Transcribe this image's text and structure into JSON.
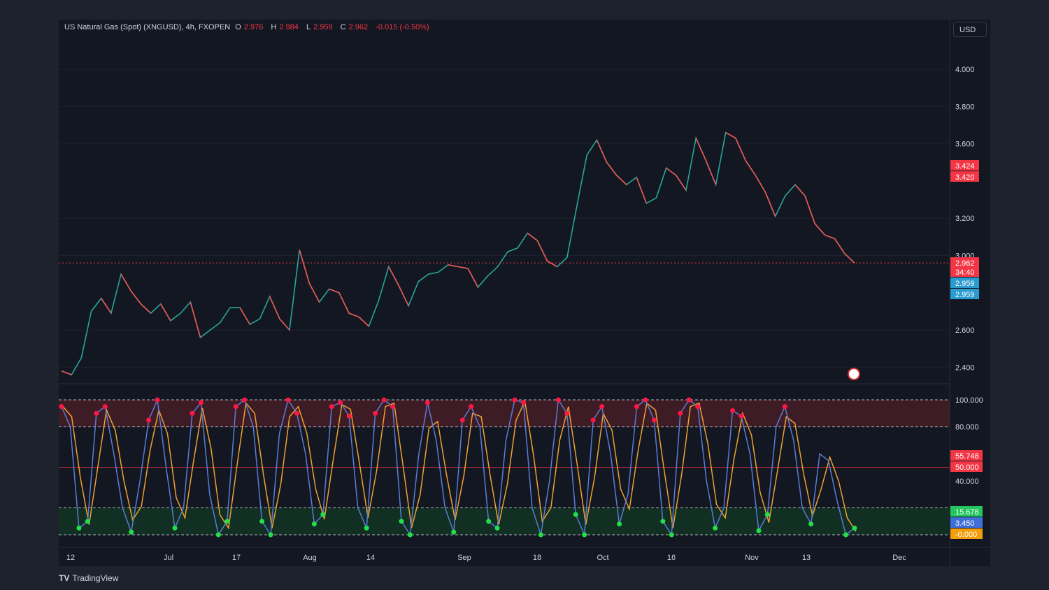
{
  "header": {
    "symbol": "US Natural Gas (Spot) (XNGUSD), 4h, FXOPEN",
    "o_label": "O",
    "o_value": "2.976",
    "h_label": "H",
    "h_value": "2.984",
    "l_label": "L",
    "l_value": "2.959",
    "c_label": "C",
    "c_value": "2.962",
    "change": "-0.015 (-0.50%)"
  },
  "currency_button": "USD",
  "branding": "TradingView",
  "colors": {
    "up": "#26a69a",
    "down": "#ef5350",
    "background": "#131722",
    "overbought": "#5c1f2a",
    "oversold": "#113b22",
    "k_line": "#5b7bd5",
    "d_line": "#f0a030"
  },
  "chart_data": [
    {
      "type": "line",
      "panel": "price",
      "y_ticks": [
        "4.000",
        "3.800",
        "3.600",
        "3.200",
        "3.000",
        "2.600",
        "2.400"
      ],
      "x_ticks": [
        "12",
        "Jul",
        "17",
        "Aug",
        "14",
        "Sep",
        "18",
        "Oct",
        "16",
        "Nov",
        "13",
        "Dec"
      ],
      "ylim": [
        2.3,
        4.2
      ],
      "series": [
        {
          "values": [
            2.38,
            2.36,
            2.45,
            2.7,
            2.77,
            2.69,
            2.9,
            2.81,
            2.74,
            2.69,
            2.74,
            2.65,
            2.69,
            2.75,
            2.56,
            2.6,
            2.64,
            2.72,
            2.72,
            2.63,
            2.66,
            2.78,
            2.66,
            2.6,
            3.03,
            2.85,
            2.75,
            2.82,
            2.8,
            2.69,
            2.67,
            2.62,
            2.76,
            2.94,
            2.84,
            2.73,
            2.86,
            2.9,
            2.91,
            2.95,
            2.94,
            2.93,
            2.83,
            2.89,
            2.94,
            3.02,
            3.04,
            3.12,
            3.08,
            2.97,
            2.94,
            2.99,
            3.27,
            3.54,
            3.62,
            3.5,
            3.43,
            3.38,
            3.42,
            3.28,
            3.31,
            3.47,
            3.43,
            3.35,
            3.63,
            3.51,
            3.38,
            3.66,
            3.63,
            3.51,
            3.43,
            3.34,
            3.21,
            3.32,
            3.38,
            3.32,
            3.17,
            3.11,
            3.09,
            3.01,
            2.96
          ]
        }
      ],
      "price_labels": [
        {
          "text": "3.424",
          "color": "#f23645"
        },
        {
          "text": "3.420",
          "color": "#f23645"
        },
        {
          "text": "2.962",
          "color": "#f23645"
        },
        {
          "text": "34:40",
          "color": "#f23645"
        },
        {
          "text": "2.959",
          "color": "#2b9ccf"
        },
        {
          "text": "2.959",
          "color": "#2b9ccf"
        }
      ]
    },
    {
      "type": "line",
      "panel": "stochastic",
      "y_ticks": [
        "100.000",
        "80.000",
        "40.000"
      ],
      "ylim": [
        0,
        100
      ],
      "levels": [
        100,
        80,
        50,
        20,
        0
      ],
      "value_labels": [
        {
          "text": "55.748",
          "color": "#f23645"
        },
        {
          "text": "50.000",
          "color": "#f23645"
        },
        {
          "text": "15.678",
          "color": "#22c55e"
        },
        {
          "text": "3.450",
          "color": "#3f6fd9"
        },
        {
          "text": "-0.000",
          "color": "#f59e0b"
        }
      ],
      "series": [
        {
          "values": [
            95,
            80,
            5,
            10,
            90,
            95,
            60,
            20,
            2,
            40,
            85,
            100,
            50,
            5,
            20,
            90,
            98,
            30,
            0,
            10,
            95,
            100,
            80,
            10,
            0,
            75,
            100,
            90,
            60,
            8,
            15,
            95,
            98,
            88,
            20,
            5,
            90,
            100,
            95,
            10,
            0,
            60,
            98,
            70,
            20,
            2,
            85,
            95,
            80,
            10,
            5,
            70,
            100,
            98,
            20,
            0,
            40,
            100,
            90,
            15,
            0,
            85,
            95,
            60,
            8,
            30,
            95,
            100,
            85,
            10,
            0,
            90,
            100,
            95,
            40,
            5,
            20,
            92,
            88,
            60,
            3,
            15,
            80,
            95,
            70,
            20,
            8,
            60,
            55,
            25,
            0,
            5
          ]
        }
      ]
    }
  ]
}
